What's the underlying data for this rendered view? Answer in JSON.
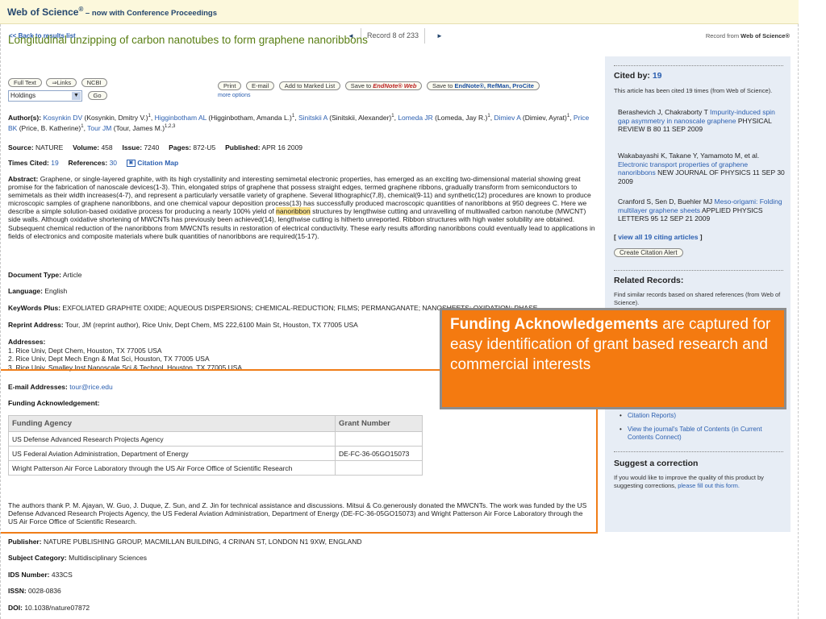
{
  "header": {
    "brand": "Web of Science",
    "reg": "®",
    "tagline": "– now with Conference Proceedings"
  },
  "nav": {
    "back": "<< Back to results list",
    "prev_icon": "◄",
    "record_label": "Record 8  of  233",
    "next_icon": "►",
    "record_from_prefix": "Record from ",
    "record_from_source": "Web of Science®"
  },
  "article": {
    "title": "Longitudinal unzipping of carbon nanotubes to form graphene nanoribbons"
  },
  "buttons": {
    "full_text": "Full Text",
    "links": "⇒Links",
    "ncbi": "NCBI",
    "holdings_value": "Holdings",
    "go": "Go",
    "print": "Print",
    "email": "E-mail",
    "add_marked": "Add to Marked List",
    "save_prefix": "Save to ",
    "endnote_web": "EndNote® Web",
    "save_prefix2": "Save to ",
    "endnote_refman": "EndNote®, RefMan, ProCite",
    "more_options": "more options"
  },
  "record": {
    "authors_label": "Author(s):",
    "authors": [
      {
        "link": "Kosynkin DV",
        "full": " (Kosynkin, Dmitry V.)",
        "sup": "1",
        "sep": ", "
      },
      {
        "link": "Higginbotham AL",
        "full": " (Higginbotham, Amanda L.)",
        "sup": "1",
        "sep": ", "
      },
      {
        "link": "Sinitskii A",
        "full": " (Sinitskii, Alexander)",
        "sup": "1",
        "sep": ", "
      },
      {
        "link": "Lomeda JR",
        "full": " (Lomeda, Jay R.)",
        "sup": "1",
        "sep": ", "
      },
      {
        "link": "Dimiev A",
        "full": " (Dimiev, Ayrat)",
        "sup": "1",
        "sep": ", "
      },
      {
        "link": "Price BK",
        "full": " (Price, B. Katherine)",
        "sup": "1",
        "sep": ", "
      },
      {
        "link": "Tour JM",
        "full": " (Tour, James M.)",
        "sup": "1,2,3",
        "sep": ""
      }
    ],
    "source_label": "Source:",
    "source": "NATURE",
    "volume_label": "Volume:",
    "volume": "458",
    "issue_label": "Issue:",
    "issue": "7240",
    "pages_label": "Pages:",
    "pages": "872-U5",
    "published_label": "Published:",
    "published": "APR 16 2009",
    "times_cited_label": "Times Cited:",
    "times_cited": "19",
    "references_label": "References:",
    "references": "30",
    "citation_map": "Citation Map",
    "abstract_label": "Abstract:",
    "abstract_pre": "Graphene, or single-layered graphite, with its high crystallinity and interesting semimetal electronic properties, has emerged as an exciting two-dimensional material showing great promise for the fabrication of nanoscale devices(1-3). Thin, elongated strips of graphene that possess straight edges, termed graphene ribbons, gradually transform from semiconductors to semimetals as their width increases(4-7), and represent a particularly versatile variety of graphene. Several lithographic(7,8), chemical(9-11) and synthetic(12) procedures are known to produce microscopic samples of graphene nanoribbons, and one chemical vapour deposition process(13) has successfully produced macroscopic quantities of nanoribbons at 950 degrees C. Here we describe a simple solution-based oxidative process for producing a nearly 100% yield of ",
    "abstract_hl": "nanoribbon",
    "abstract_post": " structures by lengthwise cutting and unravelling of multiwalled carbon nanotube (MWCNT) side walls. Although oxidative shortening of MWCNTs has previously been achieved(14), lengthwise cutting is hitherto unreported. Ribbon structures with high water solubility are obtained. Subsequent chemical reduction of the nanoribbons from MWCNTs results in restoration of electrical conductivity. These early results affording nanoribbons could eventually lead to applications in fields of electronics and composite materials where bulk quantities of nanoribbons are required(15-17).",
    "doctype_label": "Document Type:",
    "doctype": "Article",
    "language_label": "Language:",
    "language": "English",
    "keywords_label": "KeyWords Plus:",
    "keywords": "EXFOLIATED GRAPHITE OXIDE; AQUEOUS DISPERSIONS; CHEMICAL-REDUCTION; FILMS; PERMANGANATE; NANOSHEETS; OXIDATION; PHASE",
    "reprint_label": "Reprint Address:",
    "reprint": "Tour, JM (reprint author), Rice Univ, Dept Chem, MS 222,6100 Main St, Houston, TX 77005 USA",
    "addresses_label": "Addresses:",
    "addresses": [
      "1. Rice Univ, Dept Chem, Houston, TX 77005 USA",
      "2. Rice Univ, Dept Mech Engn & Mat Sci, Houston, TX 77005 USA",
      "3. Rice Univ, Smalley Inst Nanoscale Sci & Technol, Houston, TX 77005 USA"
    ],
    "email_label": "E-mail Addresses:",
    "email": "tour@rice.edu",
    "funding_label": "Funding Acknowledgement:",
    "funding_headers": [
      "Funding Agency",
      "Grant Number"
    ],
    "funding_rows": [
      [
        "US Defense Advanced Research Projects Agency",
        ""
      ],
      [
        "US Federal Aviation Administration, Department of Energy",
        "DE-FC-36-05GO15073"
      ],
      [
        "Wright Patterson Air Force Laboratory through the US Air Force Office of Scientific Research",
        ""
      ]
    ],
    "funding_text": "The authors thank P. M. Ajayan, W. Guo, J. Duque, Z. Sun, and Z. Jin for technical assistance and discussions. Mitsui & Co.generously donated the MWCNTs. The work was funded by the US Defense Advanced Research Projects Agency, the US Federal Aviation Administration, Department of Energy (DE-FC-36-05GO15073) and Wright Patterson Air Force Laboratory through the US Air Force Office of Scientific Research.",
    "publisher_label": "Publisher:",
    "publisher": "NATURE PUBLISHING GROUP, MACMILLAN BUILDING, 4 CRINAN ST, LONDON N1 9XW, ENGLAND",
    "subject_label": "Subject Category:",
    "subject": "Multidisciplinary Sciences",
    "ids_label": "IDS Number:",
    "ids": "433CS",
    "issn_label": "ISSN:",
    "issn": "0028-0836",
    "doi_label": "DOI:",
    "doi": "10.1038/nature07872"
  },
  "sidebar": {
    "cited_by_label": "Cited by:",
    "cited_by_count": "19",
    "cited_note": "This article has been cited 19 times (from Web of Science).",
    "refs": [
      {
        "authors": "Berashevich J, Chakraborty T ",
        "title": "Impurity-induced spin gap asymmetry in nanoscale graphene",
        "source": " PHYSICAL REVIEW B 80 11 SEP 2009"
      },
      {
        "authors": "Wakabayashi K, Takane Y, Yamamoto M, et al. ",
        "title": "Electronic transport properties of graphene nanoribbons",
        "source": " NEW JOURNAL OF PHYSICS 11 SEP 30 2009"
      },
      {
        "authors": "Cranford S, Sen D, Buehler MJ ",
        "title": "Meso-origami: Folding multilayer graphene sheets",
        "source": " APPLIED PHYSICS LETTERS 95 12 SEP 21 2009"
      }
    ],
    "view_all_open": "[ ",
    "view_all": "view all 19 citing articles",
    "view_all_close": " ]",
    "create_alert": "Create Citation Alert",
    "related_label": "Related Records:",
    "related_note": "Find similar records based on shared references (from Web of Science).",
    "impact_tail": "Citation Reports)",
    "toc": "View the journal's Table of Contents (in Current Contents Connect)",
    "suggest_label": "Suggest a correction",
    "suggest_text": "If you would like to improve the quality of this product by suggesting corrections, ",
    "suggest_link": "please fill out this form."
  },
  "callout": {
    "bold": "Funding Acknowledgements",
    "rest": " are captured for easy identification of  grant based research and commercial interests"
  },
  "colors": {
    "title": "#5a7f14",
    "link": "#2b5fb0",
    "callout": "#f47a10",
    "sidebar": "#e7edf5"
  }
}
